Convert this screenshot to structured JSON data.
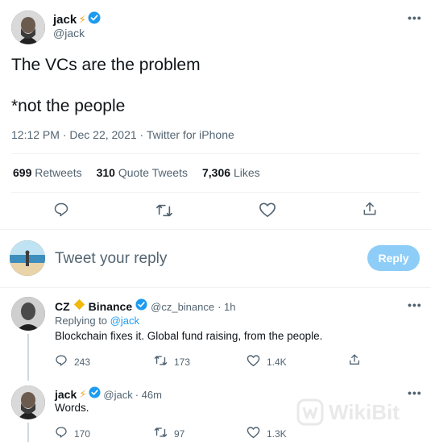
{
  "main_tweet": {
    "author_name": "jack",
    "author_emoji": "⚡",
    "author_handle": "@jack",
    "text_line1": "The VCs are the problem",
    "text_line2": "*not the people",
    "meta": "12:12 PM · Dec 22, 2021 · Twitter for iPhone",
    "retweets_count": "699",
    "retweets_label": "Retweets",
    "quotes_count": "310",
    "quotes_label": "Quote Tweets",
    "likes_count": "7,306",
    "likes_label": "Likes"
  },
  "composer": {
    "placeholder": "Tweet your reply",
    "button_label": "Reply"
  },
  "replies": [
    {
      "author_name_a": "CZ",
      "author_name_b": "Binance",
      "author_handle": "@cz_binance",
      "time": "· 1h",
      "replying_prefix": "Replying to",
      "replying_to": "@jack",
      "text": "Blockchain fixes it. Global fund raising, from the people.",
      "reply_count": "243",
      "retweet_count": "173",
      "like_count": "1.4K"
    },
    {
      "author_name": "jack",
      "author_emoji": "⚡",
      "author_handle": "@jack",
      "time": "· 46m",
      "text": "Words.",
      "reply_count": "170",
      "retweet_count": "97",
      "like_count": "1.3K"
    }
  ],
  "watermark": "WikiBit",
  "colors": {
    "accent": "#1d9bf0",
    "reply_button_disabled": "#8ecdf8",
    "muted_text": "#536471",
    "divider": "#eff3f4",
    "binance_diamond": "#f0b90b"
  },
  "icons": [
    "more-icon",
    "verified-badge-icon",
    "reply-icon",
    "retweet-icon",
    "like-icon",
    "share-icon",
    "binance-diamond-icon"
  ]
}
